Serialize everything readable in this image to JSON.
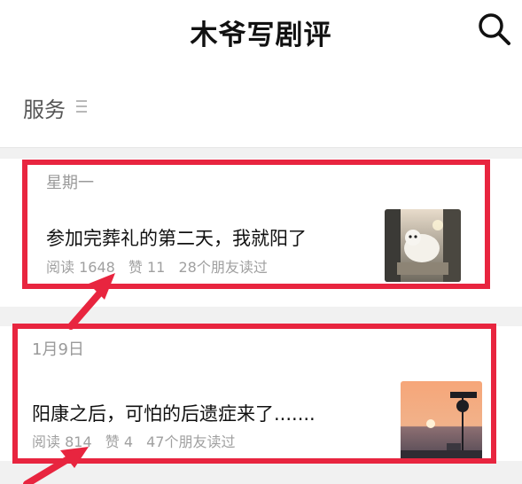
{
  "header": {
    "title": "木爷写剧评",
    "search_icon": "search-icon"
  },
  "menu": {
    "services_label": "服务",
    "menu_icon": "menu-lines-icon"
  },
  "colors": {
    "highlight": "#e8253f",
    "text": "#111111",
    "muted": "#a0a0a0"
  },
  "articles": [
    {
      "date": "星期一",
      "title": "参加完葬礼的第二天，我就阳了",
      "reads": "阅读 1648",
      "likes": "赞 11",
      "friends": "28个朋友读过",
      "thumbnail_icon": "illustration-thumbnail"
    },
    {
      "date": "1月9日",
      "title": "阳康之后，可怕的后遗症来了.......",
      "reads": "阅读 814",
      "likes": "赞 4",
      "friends": "47个朋友读过",
      "thumbnail_icon": "sunset-photo-thumbnail"
    }
  ]
}
